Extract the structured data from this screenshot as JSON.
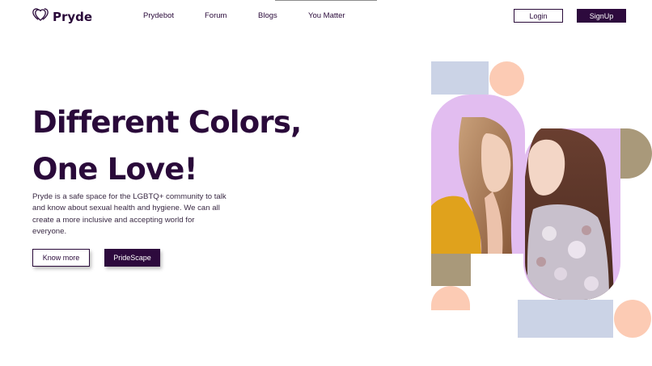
{
  "brand": {
    "name": "Pryde",
    "logo_icon": "hearts-icon"
  },
  "nav": {
    "links": [
      "Prydebot",
      "Forum",
      "Blogs",
      "You Matter"
    ],
    "login_label": "Login",
    "signup_label": "SignUp"
  },
  "hero": {
    "title_line1": "Different Colors,",
    "title_line2": "One Love!",
    "description": "Pryde is a safe space for the LGBTQ+ community to talk and know about sexual health and hygiene. We can all create a more inclusive and accepting world for everyone.",
    "know_more_label": "Know more",
    "pridescape_label": "PrideScape"
  },
  "colors": {
    "primary": "#2d0a3d",
    "lavender": "#e2bdf0",
    "blue_grey": "#cbd3e6",
    "peach": "#fccbb4",
    "olive": "#a9997a"
  }
}
